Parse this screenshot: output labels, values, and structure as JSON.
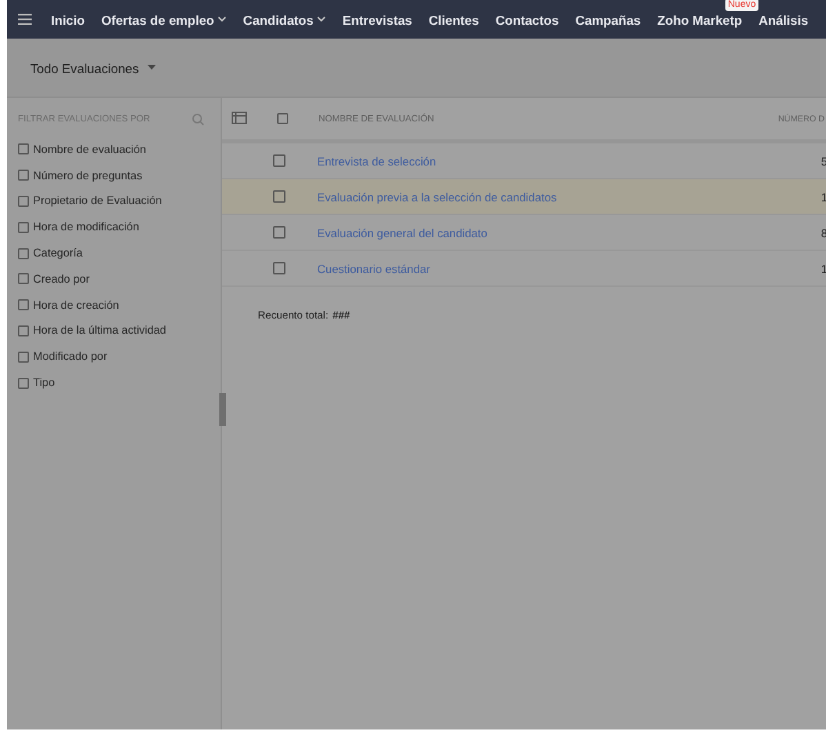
{
  "nav": {
    "items": [
      {
        "label": "Inicio",
        "dropdown": false
      },
      {
        "label": "Ofertas de empleo",
        "dropdown": true
      },
      {
        "label": "Candidatos",
        "dropdown": true
      },
      {
        "label": "Entrevistas",
        "dropdown": false
      },
      {
        "label": "Clientes",
        "dropdown": false
      },
      {
        "label": "Contactos",
        "dropdown": false
      },
      {
        "label": "Campañas",
        "dropdown": false
      },
      {
        "label": "Zoho Marketp",
        "dropdown": false,
        "badge": "Nuevo"
      },
      {
        "label": "Análisis",
        "dropdown": false
      }
    ]
  },
  "view_selector": {
    "label": "Todo Evaluaciones"
  },
  "sidebar": {
    "title": "FILTRAR EVALUACIONES POR",
    "filters": [
      {
        "label": "Nombre de evaluación",
        "checked": false
      },
      {
        "label": "Número de preguntas",
        "checked": false
      },
      {
        "label": "Propietario de Evaluación",
        "checked": false
      },
      {
        "label": "Hora de modificación",
        "checked": false
      },
      {
        "label": "Categoría",
        "checked": false
      },
      {
        "label": "Creado por",
        "checked": false
      },
      {
        "label": "Hora de creación",
        "checked": false
      },
      {
        "label": "Hora de la última actividad",
        "checked": false
      },
      {
        "label": "Modificado por",
        "checked": false
      },
      {
        "label": "Tipo",
        "checked": false
      }
    ]
  },
  "table": {
    "select_all": {
      "checked": false
    },
    "columns": [
      "NOMBRE DE EVALUACIÓN",
      "NÚMERO D"
    ],
    "rows": [
      {
        "name": "Entrevista de selección",
        "column_2": "5",
        "checked": false,
        "selected": false
      },
      {
        "name": "Evaluación previa a la selección de candidatos",
        "column_2": "1",
        "checked": false,
        "selected": true
      },
      {
        "name": "Evaluación general del candidato",
        "column_2": "8",
        "checked": false,
        "selected": false
      },
      {
        "name": "Cuestionario estándar",
        "column_2": "1",
        "checked": false,
        "selected": false
      }
    ]
  },
  "total": {
    "label": "Recuento total:",
    "value": "###"
  }
}
